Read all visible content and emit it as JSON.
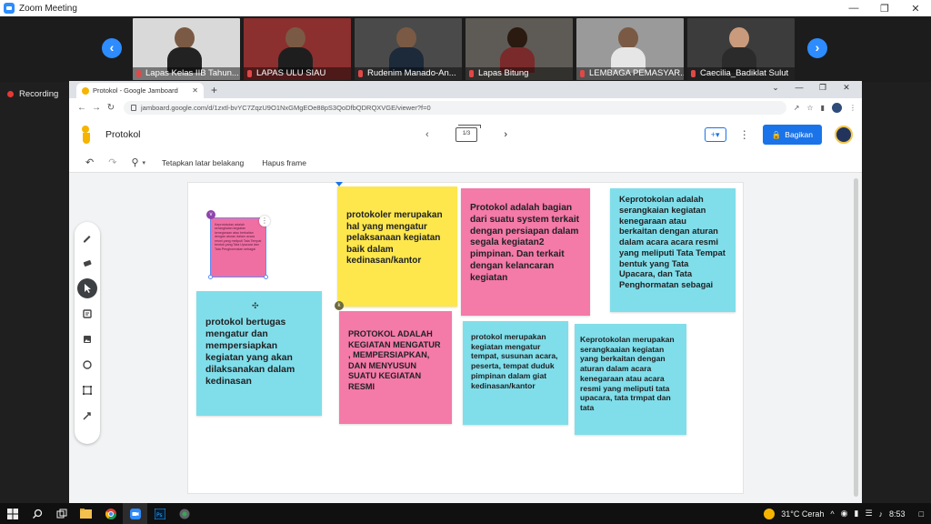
{
  "zoom": {
    "title": "Zoom Meeting",
    "recording_label": "Recording",
    "participants": [
      {
        "name": "Lapas Kelas IIB Tahun...",
        "bg": "#d9d9d9"
      },
      {
        "name": "LAPAS ULU SIAU",
        "bg": "#8c2f2f"
      },
      {
        "name": "Rudenim Manado-An...",
        "bg": "#4a4a4a"
      },
      {
        "name": "Lapas Bitung",
        "bg": "#5e5a55"
      },
      {
        "name": "LEMBAGA PEMASYAR...",
        "bg": "#9a9a9a"
      },
      {
        "name": "Caecilia_Badiklat Sulut",
        "bg": "#3c3c3c"
      }
    ]
  },
  "browser": {
    "tab_title": "Protokol - Google Jamboard",
    "url": "jamboard.google.com/d/1zxtl-bvYC7ZqzU9O1NxGMgEOe88pS3QoDfbQDRQXVGE/viewer?f=0"
  },
  "jamboard": {
    "title": "Protokol",
    "frame_indicator": "1/3",
    "share_label": "Bagikan",
    "toolbar": {
      "set_background": "Tetapkan latar belakang",
      "clear_frame": "Hapus frame"
    },
    "notes": {
      "mini": "Keprotokolan adalah serangkaian kegiatan kenegaraan atau berkaitan dengan aturan dalam acara resmi yang meliputi Tata Tempat bentuk yang Tata Upacara dan Tata Penghormatan sebagai",
      "n1": "protokoler merupakan hal yang mengatur pelaksanaan kegiatan baik dalam kedinasan/kantor",
      "n2": "Protokol adalah bagian dari suatu system terkait dengan persiapan dalam segala kegiatan2 pimpinan. Dan terkait dengan kelancaran kegiatan",
      "n3": "Keprotokolan adalah serangkaian kegiatan kenegaraan atau berkaitan dengan aturan dalam acara acara resmi yang meliputi Tata Tempat bentuk yang Tata Upacara, dan Tata Penghormatan sebagai",
      "n4": "protokol bertugas mengatur dan mempersiapkan kegiatan yang akan dilaksanakan dalam kedinasan",
      "n5": "PROTOKOL ADALAH KEGIATAN MENGATUR , MEMPERSIAPKAN, DAN MENYUSUN SUATU KEGIATAN RESMI",
      "n6": "protokol merupakan kegiatan mengatur tempat, susunan acara, peserta, tempat duduk pimpinan dalam giat kedinasan/kantor",
      "n7": "Keprotokolan merupakan serangkaaian kegiatan yang berkaitan dengan aturan dalam acara kenegaraan atau acara resmi yang meliputi tata upacara, tata trmpat dan tata"
    }
  },
  "taskbar": {
    "weather": "31°C  Cerah",
    "time": "8:53"
  }
}
